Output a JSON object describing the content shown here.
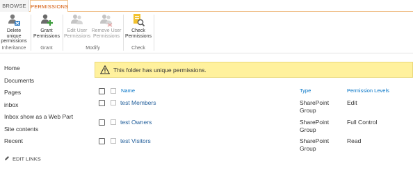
{
  "ribbon": {
    "tabs": [
      {
        "label": "BROWSE"
      },
      {
        "label": "PERMISSIONS",
        "active": true
      }
    ],
    "buttons": {
      "delete_unique": {
        "line1": "Delete unique",
        "line2": "permissions",
        "icon": "delete-permissions-icon"
      },
      "grant": {
        "line1": "Grant",
        "line2": "Permissions",
        "icon": "grant-permissions-icon"
      },
      "edit_user": {
        "line1": "Edit User",
        "line2": "Permissions",
        "icon": "edit-user-icon",
        "disabled": true
      },
      "remove_user": {
        "line1": "Remove User",
        "line2": "Permissions",
        "icon": "remove-user-icon",
        "disabled": true
      },
      "check": {
        "line1": "Check",
        "line2": "Permissions",
        "icon": "check-permissions-icon"
      }
    },
    "groups": {
      "inheritance": "Inheritance",
      "grant": "Grant",
      "modify": "Modify",
      "check": "Check"
    },
    "accent_color": "#d35400"
  },
  "nav": {
    "items": [
      {
        "label": "Home"
      },
      {
        "label": "Documents"
      },
      {
        "label": "Pages"
      },
      {
        "label": "inbox"
      },
      {
        "label": "Inbox show as a Web Part"
      },
      {
        "label": "Site contents"
      },
      {
        "label": "Recent"
      }
    ],
    "edit_links": "EDIT LINKS"
  },
  "message": {
    "text": "This folder has unique permissions.",
    "background": "#fff19d"
  },
  "table": {
    "columns": {
      "name": "Name",
      "type": "Type",
      "permission_levels": "Permission Levels"
    },
    "rows": [
      {
        "name": "test Members",
        "type_line1": "SharePoint",
        "type_line2": "Group",
        "level": "Edit"
      },
      {
        "name": "test Owners",
        "type_line1": "SharePoint",
        "type_line2": "Group",
        "level": "Full Control"
      },
      {
        "name": "test Visitors",
        "type_line1": "SharePoint",
        "type_line2": "Group",
        "level": "Read"
      }
    ],
    "link_color": "#1f5c99"
  }
}
